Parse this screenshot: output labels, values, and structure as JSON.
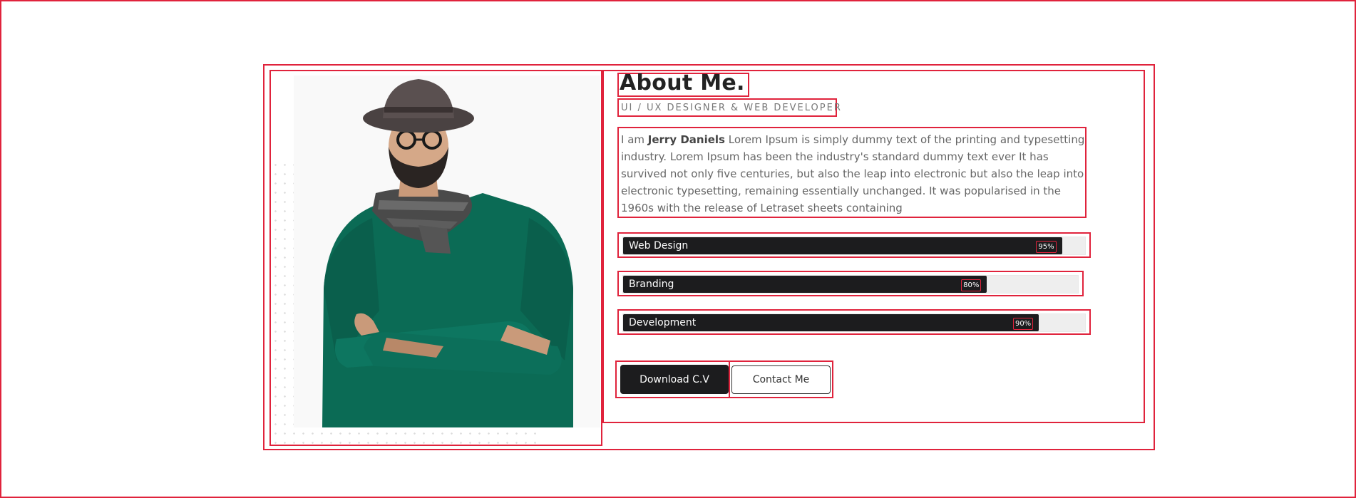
{
  "about": {
    "title": "About Me.",
    "subtitle": "UI / UX DESIGNER & WEB DEVELOPER",
    "bio_intro": "I am ",
    "bio_name": "Jerry Daniels",
    "bio_text": " Lorem Ipsum is simply dummy text of the printing and typesetting industry. Lorem Ipsum has been the industry's standard dummy text ever It has survived not only five centuries, but also the leap into electronic but also the leap into electronic typesetting, remaining essentially unchanged. It was popularised in the 1960s with the release of Letraset sheets containing"
  },
  "skills": [
    {
      "name": "Web Design",
      "percent_label": "95%",
      "value": 95
    },
    {
      "name": "Branding",
      "percent_label": "80%",
      "value": 80
    },
    {
      "name": "Development",
      "percent_label": "90%",
      "value": 90
    }
  ],
  "buttons": {
    "download": "Download C.V",
    "contact": "Contact Me"
  },
  "colors": {
    "accent_outline": "#e0233c",
    "bar_fill": "#1c1c1e",
    "sweater": "#0b6b55"
  }
}
